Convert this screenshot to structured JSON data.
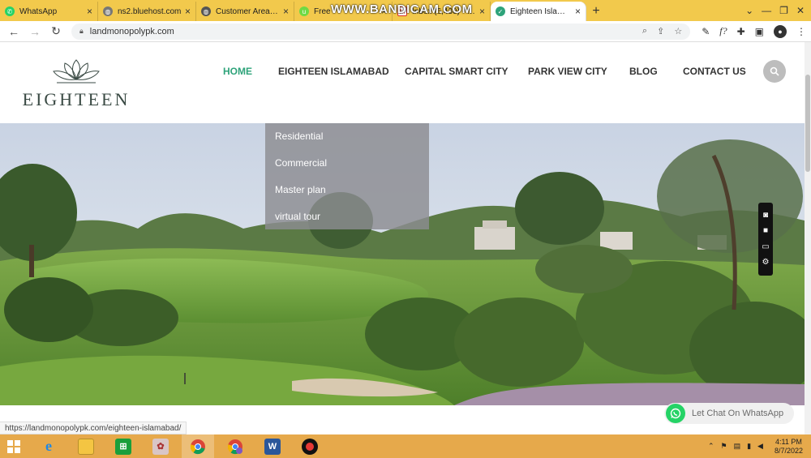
{
  "browser": {
    "tabs": [
      {
        "title": "WhatsApp",
        "color": "#25d366",
        "active": false
      },
      {
        "title": "ns2.bluehost.com",
        "color": "#777777",
        "active": false
      },
      {
        "title": "Customer Area - N",
        "color": "#555555",
        "active": false
      },
      {
        "title": "Free",
        "color": "#6fda44",
        "active": false
      },
      {
        "title": "Inbox (6,430) - zab",
        "color": "#d93025",
        "active": false
      },
      {
        "title": "Eighteen Islamaba",
        "color": "#2ea37a",
        "active": true
      }
    ],
    "new_tab": "+",
    "url": "landmonopolypk.com",
    "recorder_watermark": "WWW.BANDICAM.COM"
  },
  "site": {
    "logo_text": "EIGHTEEN",
    "nav": [
      {
        "label": "HOME",
        "active": true
      },
      {
        "label": "EIGHTEEN ISLAMABAD",
        "active": false
      },
      {
        "label": "CAPITAL SMART CITY",
        "active": false
      },
      {
        "label": "PARK VIEW CITY",
        "active": false
      },
      {
        "label": "BLOG",
        "active": false
      },
      {
        "label": "CONTACT US",
        "active": false
      }
    ],
    "dropdown": [
      "Residential",
      "Commercial",
      "Master plan",
      "virtual tour"
    ],
    "whatsapp_label": "Let Chat On WhatsApp",
    "accent": "#2ea37a"
  },
  "status_url": "https://landmonopolypk.com/eighteen-islamabad/",
  "taskbar": {
    "time": "4:11 PM",
    "date": "8/7/2022"
  }
}
